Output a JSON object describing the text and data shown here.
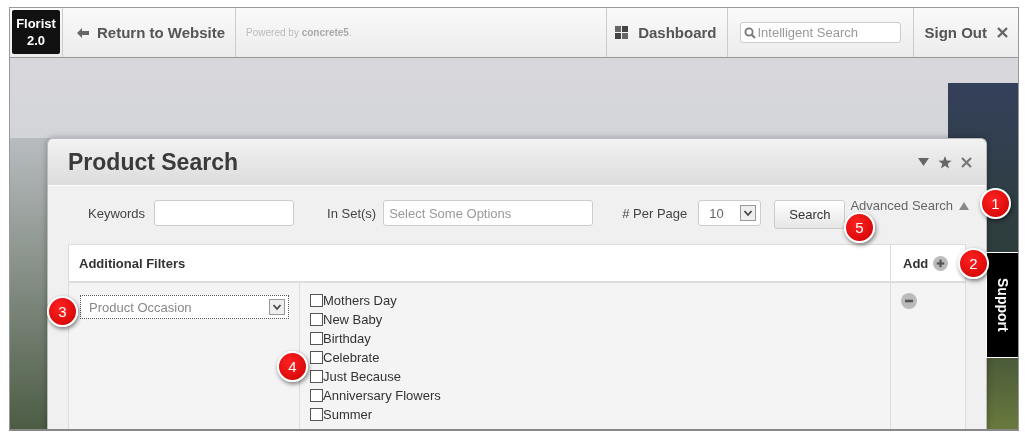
{
  "topbar": {
    "logo": [
      "Florist",
      "2.0"
    ],
    "return_link": "Return to Website",
    "powered_by": "Powered by **concrete5**.",
    "dashboard": "Dashboard",
    "search": {
      "placeholder": "Intelligent Search"
    },
    "sign_out": "Sign Out"
  },
  "dialog": {
    "title": "Product Search",
    "toolbar": {
      "keywords_label": "Keywords",
      "sets_label": "In Set(s)",
      "sets_placeholder": "Select Some Options",
      "per_page_label": "# Per Page",
      "per_page_value": "10",
      "search_button": "Search",
      "advanced_search": "Advanced Search",
      "advanced_expanded": true
    },
    "filters": {
      "header": "Additional Filters",
      "add_label": "Add",
      "rows": [
        {
          "field": "Product Occasion",
          "options": [
            {
              "label": "Mothers Day",
              "checked": false
            },
            {
              "label": "New Baby",
              "checked": false
            },
            {
              "label": "Birthday",
              "checked": false
            },
            {
              "label": "Celebrate",
              "checked": false
            },
            {
              "label": "Just Because",
              "checked": false
            },
            {
              "label": "Anniversary Flowers",
              "checked": false
            },
            {
              "label": "Summer",
              "checked": false
            }
          ]
        }
      ]
    }
  },
  "support_tab": "Support",
  "callouts": [
    {
      "label": "1"
    },
    {
      "label": "2"
    },
    {
      "label": "3"
    },
    {
      "label": "4"
    },
    {
      "label": "5"
    }
  ]
}
